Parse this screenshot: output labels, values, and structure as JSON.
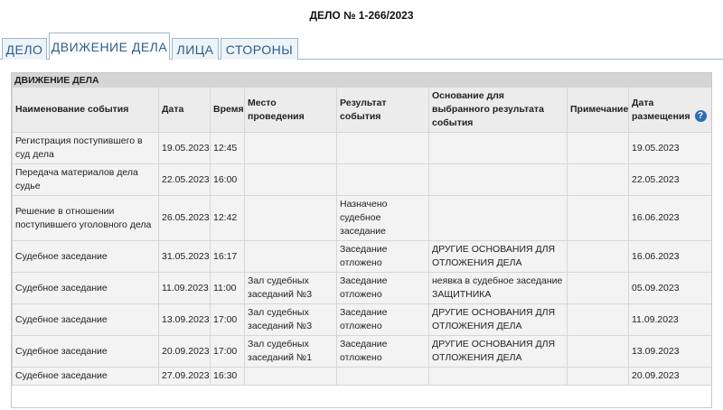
{
  "header": {
    "case_title": "ДЕЛО № 1-266/2023"
  },
  "tabs": [
    {
      "label": "ДЕЛО"
    },
    {
      "label": "ДВИЖЕНИЕ ДЕЛА"
    },
    {
      "label": "ЛИЦА"
    },
    {
      "label": "СТОРОНЫ"
    }
  ],
  "section": {
    "title": "ДВИЖЕНИЕ ДЕЛА",
    "columns": [
      "Наименование события",
      "Дата",
      "Время",
      "Место проведения",
      "Результат события",
      "Основание для выбранного результата события",
      "Примечание",
      "Дата размещения"
    ],
    "rows": [
      [
        "Регистрация поступившего в суд дела",
        "19.05.2023",
        "12:45",
        "",
        "",
        "",
        "",
        "19.05.2023"
      ],
      [
        "Передача материалов дела судье",
        "22.05.2023",
        "16:00",
        "",
        "",
        "",
        "",
        "22.05.2023"
      ],
      [
        "Решение в отношении поступившего уголовного дела",
        "26.05.2023",
        "12:42",
        "",
        "Назначено судебное заседание",
        "",
        "",
        "16.06.2023"
      ],
      [
        "Судебное заседание",
        "31.05.2023",
        "16:17",
        "",
        "Заседание отложено",
        "ДРУГИЕ ОСНОВАНИЯ ДЛЯ ОТЛОЖЕНИЯ ДЕЛА",
        "",
        "16.06.2023"
      ],
      [
        "Судебное заседание",
        "11.09.2023",
        "11:00",
        "Зал судебных заседаний №3",
        "Заседание отложено",
        "неявка в судебное заседание ЗАЩИТНИКА",
        "",
        "05.09.2023"
      ],
      [
        "Судебное заседание",
        "13.09.2023",
        "17:00",
        "Зал судебных заседаний №3",
        "Заседание отложено",
        "ДРУГИЕ ОСНОВАНИЯ ДЛЯ ОТЛОЖЕНИЯ ДЕЛА",
        "",
        "11.09.2023"
      ],
      [
        "Судебное заседание",
        "20.09.2023",
        "17:00",
        "Зал судебных заседаний №1",
        "Заседание отложено",
        "ДРУГИЕ ОСНОВАНИЯ ДЛЯ ОТЛОЖЕНИЯ ДЕЛА",
        "",
        "13.09.2023"
      ],
      [
        "Судебное заседание",
        "27.09.2023",
        "16:30",
        "",
        "",
        "",
        "",
        "20.09.2023"
      ]
    ]
  },
  "icons": {
    "help": "question-circle-icon",
    "help_glyph": "?",
    "help_color": "#2d6db5"
  },
  "colors": {
    "tab_text": "#2a5d8c",
    "section_header_bg": "#d5d5d5",
    "row_bg": "#f3f3f3"
  }
}
